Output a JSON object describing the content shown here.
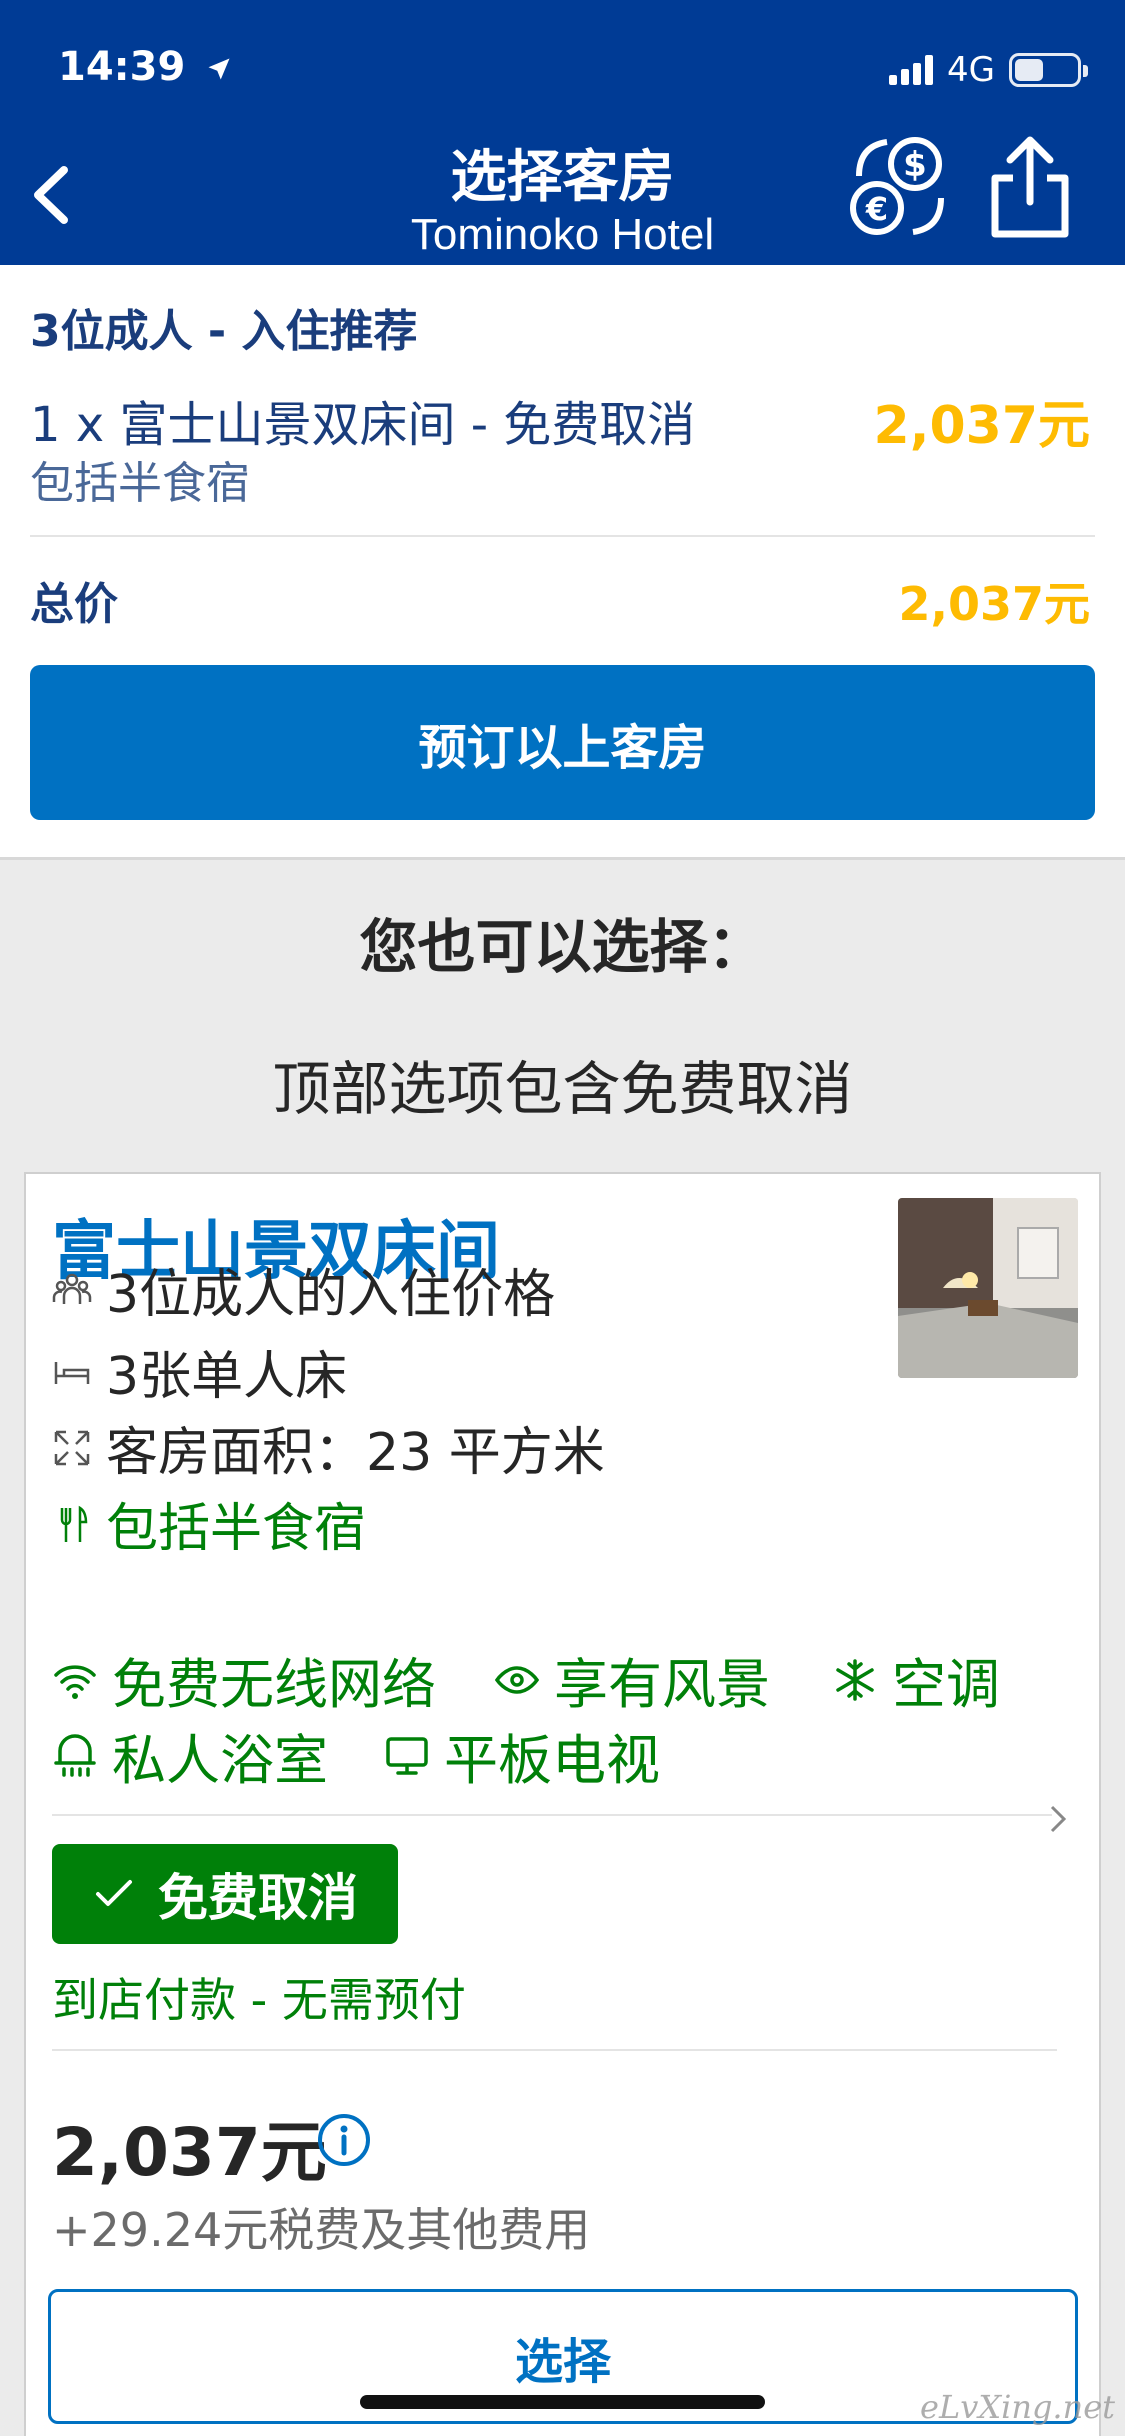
{
  "status_bar": {
    "time": "14:39",
    "network": "4G"
  },
  "header": {
    "title": "选择客房",
    "subtitle": "Tominoko Hotel"
  },
  "summary": {
    "recommend_title": "3位成人 - 入住推荐",
    "room_line": "1 x 富士山景双床间 - 免费取消",
    "room_price": "2,037元",
    "meal": "包括半食宿",
    "total_label": "总价",
    "total_price": "2,037元",
    "book_button": "预订以上客房"
  },
  "alternatives": {
    "title": "您也可以选择：",
    "subtitle": "顶部选项包含免费取消"
  },
  "room": {
    "name": "富士山景双床间",
    "features": [
      {
        "icon": "people-icon",
        "text": "3位成人的入住价格"
      },
      {
        "icon": "bed-icon",
        "text": "3张单人床"
      },
      {
        "icon": "expand-icon",
        "text": "客房面积：23 平方米"
      },
      {
        "icon": "fork-knife-icon",
        "text": "包括半食宿"
      }
    ],
    "amenities": [
      {
        "icon": "wifi-icon",
        "text": "免费无线网络"
      },
      {
        "icon": "eye-icon",
        "text": "享有风景"
      },
      {
        "icon": "snowflake-icon",
        "text": "空调"
      },
      {
        "icon": "shower-icon",
        "text": "私人浴室"
      },
      {
        "icon": "tv-icon",
        "text": "平板电视"
      }
    ],
    "free_cancel": "免费取消",
    "payment": "到店付款 - 无需预付",
    "price": "2,037元",
    "taxes": "+29.24元税费及其他费用",
    "select_button": "选择"
  },
  "watermark": "eLvXing.net",
  "colors": {
    "brand_blue": "#003b95",
    "action_blue": "#0071c2",
    "price_yellow": "#febb02",
    "success_green": "#008009"
  }
}
